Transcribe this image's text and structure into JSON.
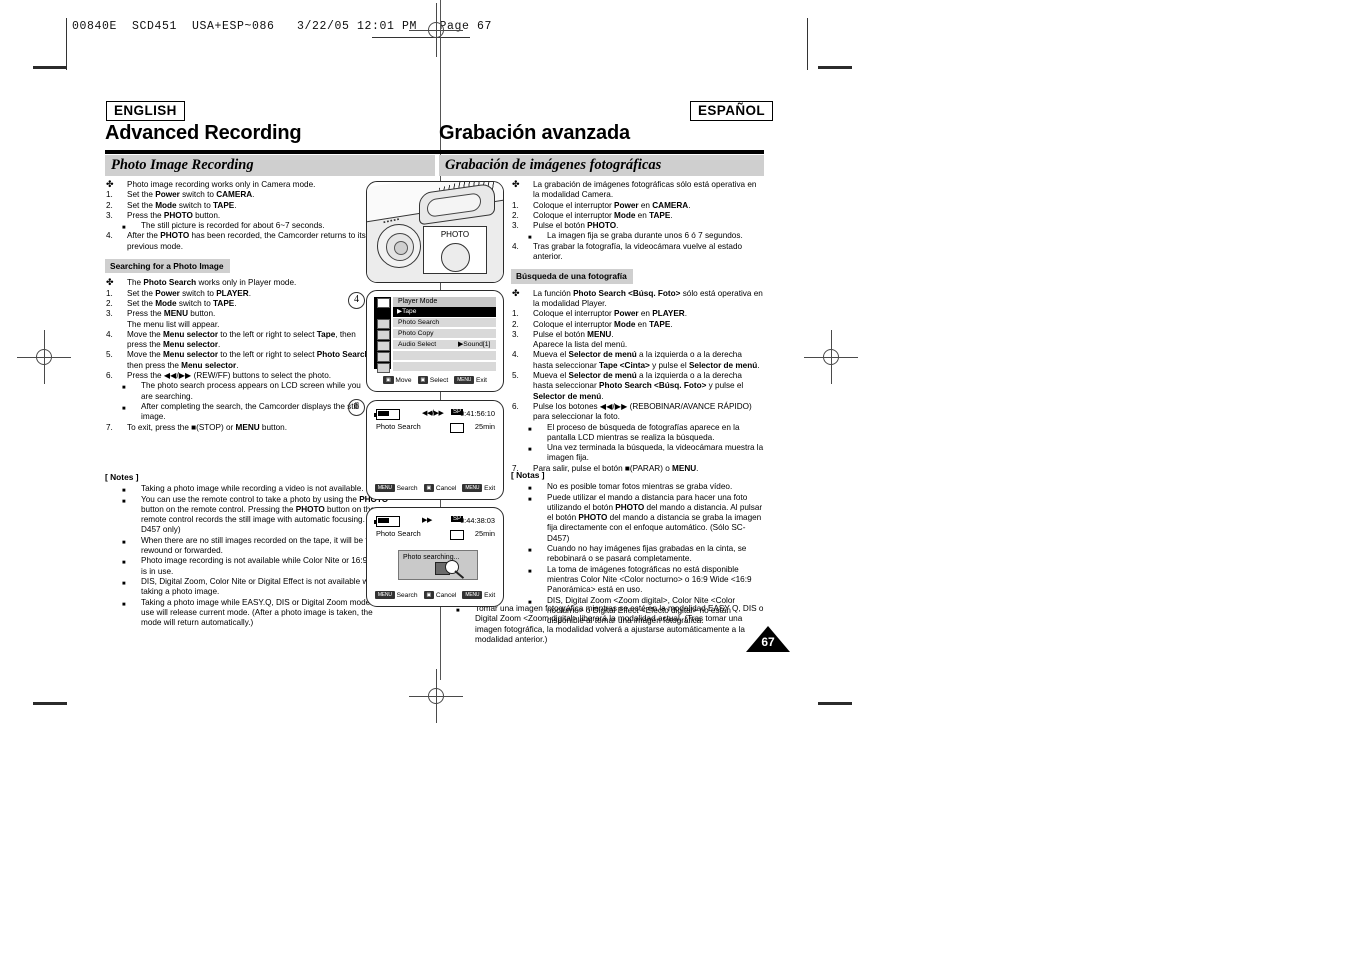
{
  "print_header": {
    "text": "00840E  SCD451  USA+ESP~086   3/22/05 12:01 PM   Page 67"
  },
  "english": {
    "lang_label": "ENGLISH",
    "chapter_title": "Advanced Recording",
    "section_title": "Photo Image Recording",
    "intro": [
      {
        "mark": "✤",
        "text": "Photo image recording works only in Camera mode."
      },
      {
        "mark": "1.",
        "text": "Set the Power switch to CAMERA."
      },
      {
        "mark": "2.",
        "text": "Set the Mode switch to TAPE."
      },
      {
        "mark": "3.",
        "text": "Press the PHOTO button."
      },
      {
        "mark": "■",
        "text": "The still picture is recorded for about 6~7 seconds.",
        "sub": true
      },
      {
        "mark": "4.",
        "text": "After the PHOTO has been recorded, the Camcorder returns to its previous mode."
      }
    ],
    "subhead": "Searching for a Photo Image",
    "steps": [
      {
        "mark": "✤",
        "text": "The Photo Search works only in Player mode."
      },
      {
        "mark": "1.",
        "text": "Set the Power switch to PLAYER."
      },
      {
        "mark": "2.",
        "text": "Set the Mode switch to TAPE."
      },
      {
        "mark": "3.",
        "text": "Press the MENU button.\nThe menu list will appear."
      },
      {
        "mark": "4.",
        "text": "Move the Menu selector to the left or right to select Tape, then press the Menu selector."
      },
      {
        "mark": "5.",
        "text": "Move the Menu selector to the left or right to select Photo Search, then press the Menu selector."
      },
      {
        "mark": "6.",
        "text": "Press the ◀◀/▶▶ (REW/FF) buttons to select the photo."
      },
      {
        "mark": "■",
        "text": "The photo search process appears on LCD screen while you are searching.",
        "sub": true
      },
      {
        "mark": "■",
        "text": "After completing the search, the Camcorder displays the still image.",
        "sub": true
      },
      {
        "mark": "7.",
        "text": "To exit, press the ■(STOP) or MENU button."
      }
    ],
    "notes_heading": "[ Notes ]",
    "notes": [
      "Taking a photo image while recording a video is not available.",
      "You can use the remote control to take a photo by using the PHOTO button on the remote control. Pressing the PHOTO button on the remote control records the still image with automatic focusing. (SC-D457 only)",
      "When there are no still images recorded on the tape, it will be fully rewound or forwarded.",
      "Photo image recording is not available while Color Nite or 16:9 Wide is in use.",
      "DIS, Digital Zoom, Color Nite or Digital Effect is not available when taking a photo image.",
      "Taking a photo image while EASY.Q, DIS or Digital Zoom mode is in use will release current mode. (After a photo image is taken, the mode will return automatically.)"
    ]
  },
  "spanish": {
    "lang_label": "ESPAÑOL",
    "chapter_title": "Grabación avanzada",
    "section_title": "Grabación de imágenes fotográficas",
    "intro": [
      {
        "mark": "✤",
        "text": "La grabación de imágenes fotográficas sólo está operativa en la modalidad Camera."
      },
      {
        "mark": "1.",
        "text": "Coloque el interruptor Power en CAMERA."
      },
      {
        "mark": "2.",
        "text": "Coloque el interruptor Mode en TAPE."
      },
      {
        "mark": "3.",
        "text": "Pulse el botón PHOTO."
      },
      {
        "mark": "■",
        "text": "La imagen fija se graba durante unos 6 ó 7 segundos.",
        "sub": true
      },
      {
        "mark": "4.",
        "text": "Tras grabar la fotografía, la videocámara vuelve al estado anterior."
      }
    ],
    "subhead": "Búsqueda de una fotografía",
    "steps": [
      {
        "mark": "✤",
        "text": "La función Photo Search <Búsq. Foto> sólo está operativa en la modalidad Player."
      },
      {
        "mark": "1.",
        "text": "Coloque el interruptor Power en PLAYER."
      },
      {
        "mark": "2.",
        "text": "Coloque el interruptor Mode en TAPE."
      },
      {
        "mark": "3.",
        "text": "Pulse el botón MENU.\nAparece la lista del menú."
      },
      {
        "mark": "4.",
        "text": "Mueva el Selector de menú a la izquierda o a la derecha hasta seleccionar Tape <Cinta> y pulse el Selector de menú."
      },
      {
        "mark": "5.",
        "text": "Mueva el Selector de menú a la izquierda o a la derecha hasta seleccionar Photo Search <Búsq. Foto> y pulse el Selector de menú."
      },
      {
        "mark": "6.",
        "text": "Pulse los botones ◀◀/▶▶ (REBOBINAR/AVANCE RÁPIDO) para seleccionar la foto."
      },
      {
        "mark": "■",
        "text": "El proceso de búsqueda de fotografías aparece en la pantalla LCD mientras se realiza la búsqueda.",
        "sub": true
      },
      {
        "mark": "■",
        "text": "Una vez terminada la búsqueda, la videocámara muestra la imagen fija.",
        "sub": true
      },
      {
        "mark": "7.",
        "text": "Para salir, pulse el botón ■(PARAR) o MENU."
      }
    ],
    "notes_heading": "[ Notas ]",
    "notes": [
      "No es posible tomar fotos mientras se graba vídeo.",
      "Puede utilizar el mando a distancia para hacer una foto utilizando el botón PHOTO del mando a distancia. Al pulsar el botón PHOTO del mando a distancia se graba la imagen fija directamente con el enfoque automático. (Sólo SC-D457)",
      "Cuando no hay imágenes fijas grabadas en la cinta, se rebobinará o se pasará completamente.",
      "La toma de imágenes fotográficas no está disponible mientras Color Nite <Color nocturno> o 16:9 Wide <16:9 Panorámica> está en uso.",
      "DIS, Digital Zoom <Zoom digital>, Color Nite <Color nocturno> o Digital Effect <Efecto digital> no están disponible al tomar una imagen fotográfica."
    ],
    "tail_note": "Tomar una imagen fotográfica mientras se esté en la modalidad EASY Q, DIS o Digital Zoom <Zoom digital> liberará la modalidad actual. (Tras tomar una imagen fotográfica, la modalidad volverá a ajustarse automáticamente a la modalidad anterior.)"
  },
  "figures": {
    "camcorder": {
      "photo_label": "PHOTO"
    },
    "step4_number": "4",
    "step6_number": "6",
    "menu_screen": {
      "title": "Player Mode",
      "selected": "▶Tape",
      "rows": [
        "Photo Search",
        "Photo Copy",
        "Audio Select",
        "",
        "",
        ""
      ],
      "audio_value": "▶Sound[1]",
      "footer": [
        {
          "key": "MENU",
          "label": "Move"
        },
        {
          "key": "OK",
          "label": "Select"
        },
        {
          "key": "MENU",
          "label": "Exit"
        }
      ]
    },
    "photo_search_1": {
      "transport": "◀◀/▶▶",
      "speed": "SP",
      "timecode": "0:41:56:10",
      "label": "Photo Search",
      "tape_remaining": "25min",
      "footer": [
        {
          "key": "MENU",
          "label": "Search"
        },
        {
          "key": "OK",
          "label": "Cancel"
        },
        {
          "key": "MENU",
          "label": "Exit"
        }
      ]
    },
    "photo_search_2": {
      "transport": "▶▶",
      "speed": "SP",
      "timecode": "0:44:38:03",
      "label": "Photo Search",
      "tape_remaining": "25min",
      "overlay": "Photo searching...",
      "footer": [
        {
          "key": "MENU",
          "label": "Search"
        },
        {
          "key": "OK",
          "label": "Cancel"
        },
        {
          "key": "MENU",
          "label": "Exit"
        }
      ]
    }
  },
  "page_number": "67"
}
